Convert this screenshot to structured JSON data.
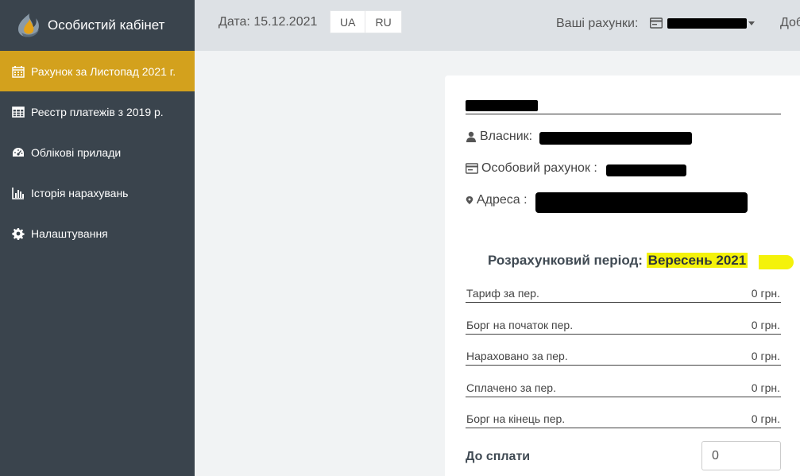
{
  "brand": {
    "name": "Особистий кабінет",
    "logo_icon": "flame-logo-icon"
  },
  "sidebar": {
    "items": [
      {
        "label": "Рахунок за Листопад 2021 г.",
        "icon": "calendar-icon",
        "active": true
      },
      {
        "label": "Реєстр платежів з 2019 р.",
        "icon": "table-icon",
        "active": false
      },
      {
        "label": "Облікові прилади",
        "icon": "gauge-icon",
        "active": false
      },
      {
        "label": "Історія нарахувань",
        "icon": "bar-chart-icon",
        "active": false
      },
      {
        "label": "Налаштування",
        "icon": "gear-icon",
        "active": false
      }
    ]
  },
  "topbar": {
    "date_label": "Дата: 15.12.2021",
    "languages": [
      "UA",
      "RU"
    ],
    "accounts_label": "Ваші рахунки:",
    "welcome_text": "Доб"
  },
  "account": {
    "owner_label": "Власник:",
    "personal_account_label": "Особовий рахунок :",
    "address_label": "Адреса :"
  },
  "billing": {
    "period_label": "Розрахунковий період:",
    "period_value": "Вересень 2021",
    "rows": [
      {
        "label": "Тариф за пер.",
        "value": "0 грн."
      },
      {
        "label": "Борг на початок пер.",
        "value": "0 грн."
      },
      {
        "label": "Нараховано за пер.",
        "value": "0 грн."
      },
      {
        "label": "Сплачено за пер.",
        "value": "0 грн."
      },
      {
        "label": "Борг на кінець пер.",
        "value": "0 грн."
      }
    ],
    "pay_label": "До сплати",
    "pay_value": "0"
  },
  "colors": {
    "sidebar_bg": "#3a444d",
    "active_item": "#d3a11d",
    "topbar_bg": "#dde1e5",
    "highlight": "#f4f20a"
  }
}
